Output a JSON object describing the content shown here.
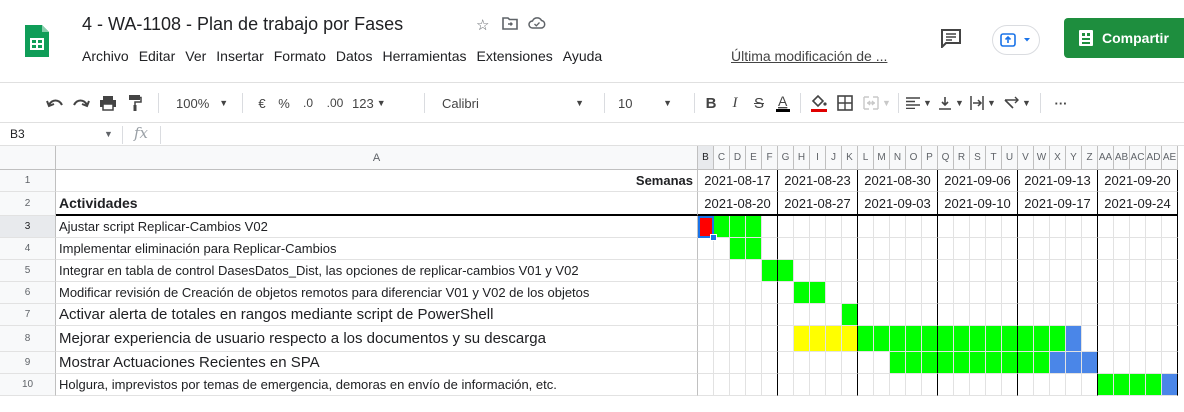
{
  "app": {
    "doc_title": "4 - WA-1108 - Plan de trabajo por Fases",
    "menu": [
      "Archivo",
      "Editar",
      "Ver",
      "Insertar",
      "Formato",
      "Datos",
      "Herramientas",
      "Extensiones",
      "Ayuda"
    ],
    "last_modified": "Última modificación de ...",
    "share_label": "Compartir"
  },
  "toolbar": {
    "zoom": "100%",
    "currency": "€",
    "percent": "%",
    "dec_decrease": ".0",
    "dec_increase": ".00",
    "format_more": "123",
    "font": "Calibri",
    "font_size": "10",
    "more": "···"
  },
  "formula_bar": {
    "name_box": "B3",
    "fx": "fx",
    "value": ""
  },
  "sheet": {
    "col_a_header": "A",
    "gantt_col_headers": [
      "B",
      "C",
      "D",
      "E",
      "F",
      "G",
      "H",
      "I",
      "J",
      "K",
      "L",
      "M",
      "N",
      "O",
      "P",
      "Q",
      "R",
      "S",
      "T",
      "U",
      "V",
      "W",
      "X",
      "Y",
      "Z",
      "AA",
      "AB",
      "AC",
      "AD",
      "AE"
    ],
    "row_numbers": [
      "1",
      "2",
      "3",
      "4",
      "5",
      "6",
      "7",
      "8",
      "9",
      "10"
    ],
    "semanas_label": "Semanas",
    "actividades_label": "Actividades",
    "week_starts": [
      "2021-08-17",
      "2021-08-23",
      "2021-08-30",
      "2021-09-06",
      "2021-09-13",
      "2021-09-20"
    ],
    "week_ends": [
      "2021-08-20",
      "2021-08-27",
      "2021-09-03",
      "2021-09-10",
      "2021-09-17",
      "2021-09-24"
    ],
    "activities": [
      "Ajustar script Replicar-Cambios V02",
      "Implementar eliminación para Replicar-Cambios",
      "Integrar en tabla de control DasesDatos_Dist, las opciones de replicar-cambios V01 y V02",
      "Modificar revisión de Creación de objetos remotos para diferenciar V01 y V02 de los objetos",
      "Activar alerta de totales en rangos mediante script de PowerShell",
      "Mejorar experiencia de usuario respecto a los documentos y su descarga",
      "Mostrar Actuaciones Recientes en SPA",
      "Holgura, imprevistos por temas de emergencia, demoras en envío de información, etc."
    ],
    "activity_font_large": [
      false,
      false,
      false,
      false,
      true,
      true,
      true,
      false
    ]
  },
  "colors": {
    "green": "#00ff00",
    "yellow": "#ffff00",
    "blue": "#4a86e8",
    "red": "#ff0000",
    "accent_share": "#1e8e3e"
  },
  "gantt": {
    "rows": [
      [
        [
          "red",
          0,
          1
        ],
        [
          "green",
          1,
          4
        ]
      ],
      [
        [
          "green",
          2,
          4
        ]
      ],
      [
        [
          "green",
          4,
          6
        ]
      ],
      [
        [
          "green",
          6,
          8
        ]
      ],
      [
        [
          "green",
          9,
          10
        ]
      ],
      [
        [
          "yellow",
          6,
          10
        ],
        [
          "green",
          10,
          23
        ],
        [
          "blue",
          23,
          24
        ]
      ],
      [
        [
          "green",
          12,
          22
        ],
        [
          "blue",
          22,
          25
        ]
      ],
      [
        [
          "green",
          25,
          29
        ],
        [
          "blue",
          29,
          30
        ]
      ]
    ]
  }
}
